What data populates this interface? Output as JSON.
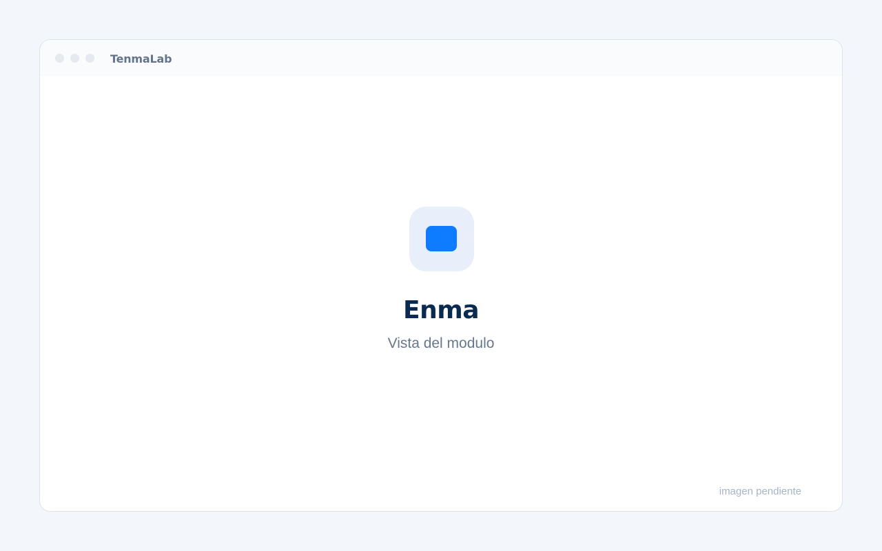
{
  "window": {
    "app_title": "TenmaLab"
  },
  "main": {
    "title": "Enma",
    "subtitle": "Vista del modulo",
    "icon": "app-icon",
    "accent_color": "#0f7bff"
  },
  "footer": {
    "status_text": "imagen pendiente"
  }
}
